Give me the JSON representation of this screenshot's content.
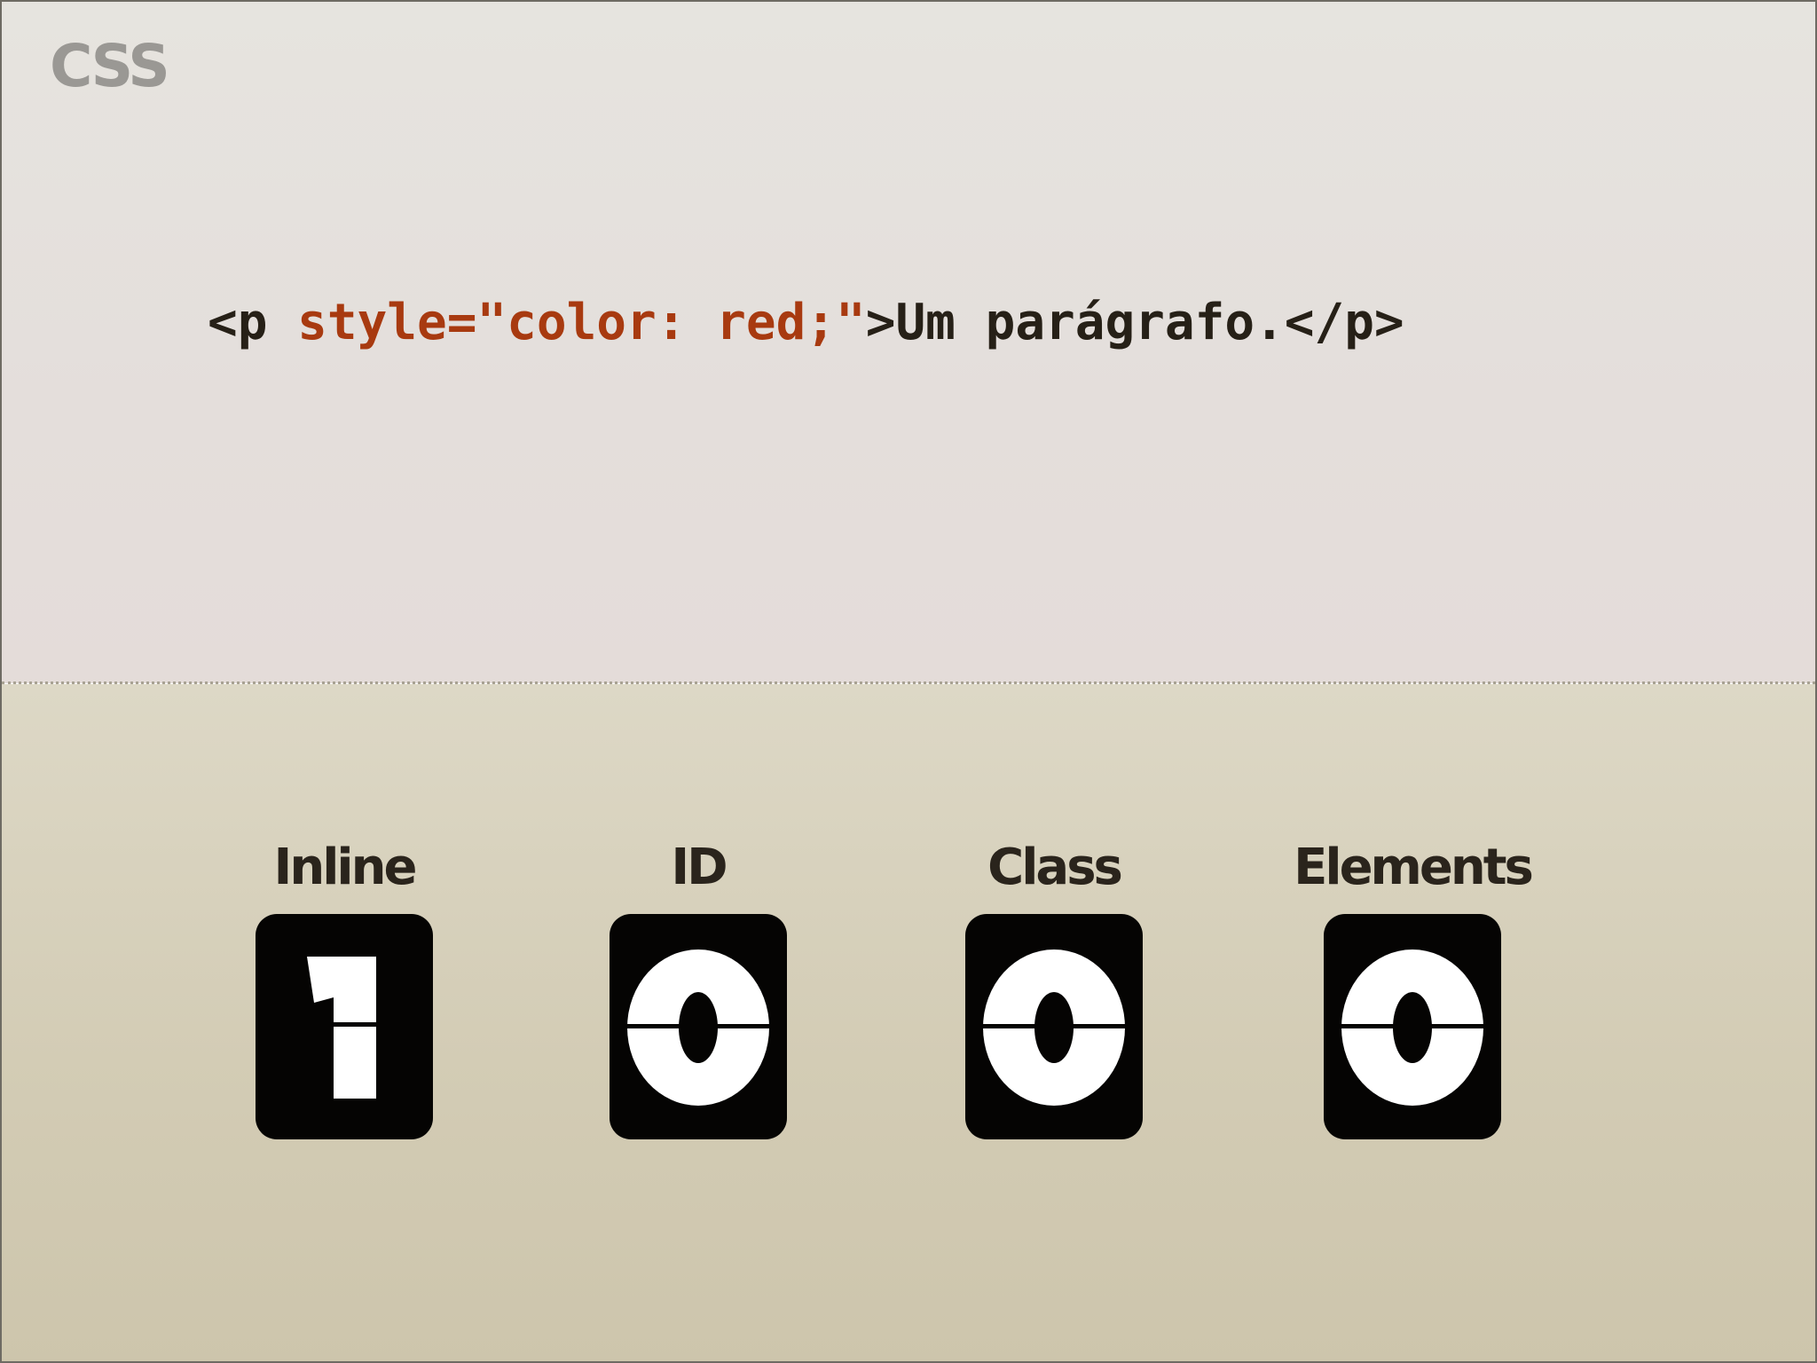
{
  "slide": {
    "logo": "CSS",
    "code": {
      "tag_open": "<p ",
      "attribute": "style=\"color: red;\"",
      "after_attr": ">Um parágrafo.</p>"
    },
    "counters": [
      {
        "label": "Inline",
        "value": "1"
      },
      {
        "label": "ID",
        "value": "0"
      },
      {
        "label": "Class",
        "value": "0"
      },
      {
        "label": "Elements",
        "value": "0"
      }
    ]
  },
  "colors": {
    "attribute": "#a83a10",
    "code_text": "#262017",
    "card": "#050403",
    "logo": "#9a9894"
  }
}
